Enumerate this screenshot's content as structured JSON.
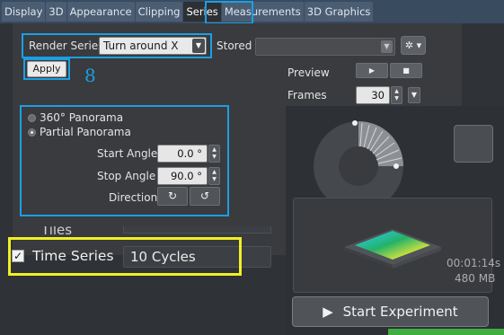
{
  "tabs": [
    {
      "label": "Display",
      "active": false
    },
    {
      "label": "3D",
      "active": false
    },
    {
      "label": "Appearance",
      "active": false
    },
    {
      "label": "Clipping",
      "active": false
    },
    {
      "label": "Series",
      "active": true
    },
    {
      "label": "Measurements",
      "active": false
    },
    {
      "label": "3D Graphics",
      "active": false
    }
  ],
  "render_series": {
    "label": "Render Series",
    "selected": "Turn around X",
    "stored_label": "Stored",
    "stored_value": "",
    "apply_label": "Apply",
    "step_annotation": "8"
  },
  "playback": {
    "preview_label": "Preview",
    "frames_label": "Frames",
    "frames_value": "30"
  },
  "panorama": {
    "option_360": "360° Panorama",
    "option_partial": "Partial Panorama",
    "selected": "partial",
    "start_angle_label": "Start Angle",
    "start_angle_value": "0.0 °",
    "stop_angle_label": "Stop Angle",
    "stop_angle_value": "90.0 °",
    "direction_label": "Direction"
  },
  "experiment": {
    "tiles_label": "Tiles",
    "time_series_label": "Time Series",
    "time_series_checked": true,
    "cycles_value": "10 Cycles",
    "duration": "00:01:14s",
    "size": "480 MB",
    "start_label": "Start Experiment"
  },
  "icons": {
    "gear": "gear-icon",
    "play": "play-icon",
    "stop": "stop-icon",
    "rotate_cw": "rotate-cw-icon",
    "rotate_ccw": "rotate-ccw-icon",
    "start": "play-triangle-icon"
  },
  "colors": {
    "highlight_blue": "#1b9fe3",
    "highlight_yellow": "#f0f024",
    "accent_green": "#3fae3f"
  }
}
